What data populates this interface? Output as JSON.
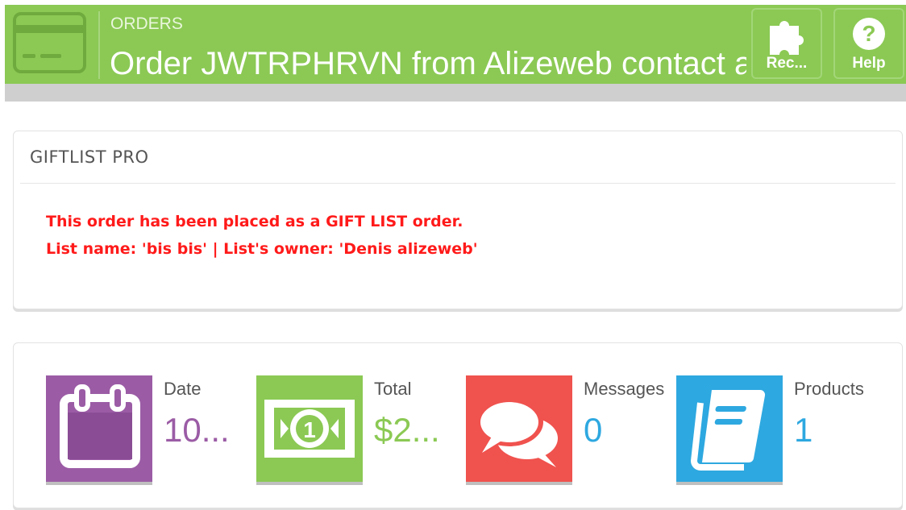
{
  "header": {
    "breadcrumb": "ORDERS",
    "title": "Order JWTRPHRVN from Alizeweb contact al",
    "icon": "credit-card-icon",
    "buttons": [
      {
        "label": "Rec...",
        "icon": "puzzle-icon"
      },
      {
        "label": "Help",
        "icon": "help-icon"
      }
    ],
    "color": "#8bc954"
  },
  "giftlist": {
    "heading": "GIFTLIST PRO",
    "message_line1": "This order has been placed as a GIFT LIST order.",
    "message_line2": "List name: 'bis bis' | List's owner: 'Denis alizeweb'",
    "message_color": "#ff1a1a"
  },
  "kpis": [
    {
      "label": "Date",
      "value": "10...",
      "icon": "calendar-icon",
      "color": "#9b5ca5"
    },
    {
      "label": "Total",
      "value": "$2...",
      "icon": "money-icon",
      "color": "#8bc954"
    },
    {
      "label": "Messages",
      "value": "0",
      "icon": "chat-bubbles-icon",
      "color": "#f0524e"
    },
    {
      "label": "Products",
      "value": "1",
      "icon": "book-icon",
      "color": "#2ea8e0"
    }
  ]
}
